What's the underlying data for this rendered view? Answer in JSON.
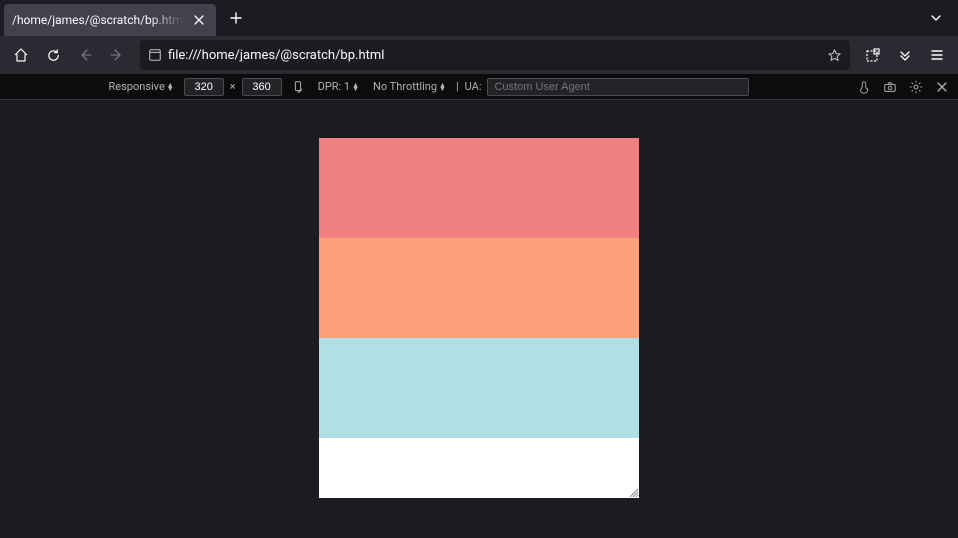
{
  "tab": {
    "title": "/home/james/@scratch/bp.html"
  },
  "urlbar": {
    "url": "file:///home/james/@scratch/bp.html"
  },
  "rdm": {
    "device_label": "Responsive",
    "width": "320",
    "height": "360",
    "dpr_label": "DPR: 1",
    "throttling_label": "No Throttling",
    "ua_label": "UA:",
    "ua_placeholder": "Custom User Agent"
  },
  "content": {
    "stripes": [
      {
        "color": "#f08080"
      },
      {
        "color": "#ffa07a"
      },
      {
        "color": "#b0e0e6"
      },
      {
        "color": "#ffffff"
      }
    ]
  }
}
